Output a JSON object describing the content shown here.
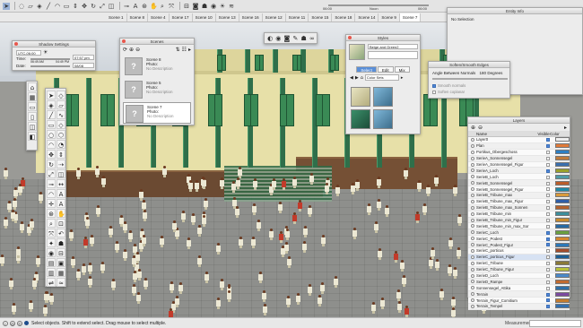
{
  "toolbar": {
    "icons": [
      "select-arrow-icon",
      "lasso-icon",
      "eraser-icon",
      "paint-bucket-icon",
      "line-icon",
      "arc-icon",
      "rectangle-icon",
      "push-pull-icon",
      "move-icon",
      "rotate-icon",
      "scale-icon",
      "offset-icon",
      "tape-measure-icon",
      "text-icon",
      "orbit-icon",
      "pan-icon",
      "zoom-icon",
      "zoom-extents-icon",
      "section-icon",
      "camera-icon",
      "walk-icon",
      "look-around-icon",
      "shadow-icon",
      "fog-icon"
    ]
  },
  "sun_bar": {
    "start_time": "06:00",
    "mid_time": "Noon",
    "end_time": "06:00"
  },
  "scene_tabs": [
    "Scene 1",
    "Scene 8",
    "Scene 4",
    "Scene 17",
    "Scene 10",
    "Scene 13",
    "Scene 16",
    "Scene 12",
    "Scene 11",
    "Scene 15",
    "Scene 18",
    "Scene 14",
    "Scene 9",
    "Scene 7"
  ],
  "active_scene_tab": "Scene 7",
  "entity_info": {
    "title": "Entity Info",
    "text": "No Selection"
  },
  "shadow_settings": {
    "title": "Shadow Settings",
    "timezone": "UTC-06:00",
    "time_label": "Time:",
    "time_start": "06:49 AM",
    "time_value": "07:57 pm",
    "time_end": "04:49 PM",
    "date_label": "Date:",
    "date_value": "08/08"
  },
  "scenes_panel": {
    "title": "Scenes",
    "items": [
      {
        "name": "Scene 8",
        "photo_label": "Photo:",
        "desc": "No Description"
      },
      {
        "name": "Scene 5",
        "photo_label": "Photo:",
        "desc": "No Description"
      },
      {
        "name": "Scene 7",
        "photo_label": "Photo:",
        "desc": "No Description"
      }
    ]
  },
  "styles_panel": {
    "title": "Styles",
    "style_name": "Beige and Green2",
    "tabs": [
      "Select",
      "Edit",
      "Mix"
    ],
    "active_tab": "Select",
    "collection": "Color Sets"
  },
  "soften_edges": {
    "title": "Soften/Smooth Edges",
    "angle_label": "Angle Between Normals",
    "angle_value": "180",
    "angle_unit": "Degrees",
    "smooth_normals": "Smooth normals",
    "soften_coplanar": "Soften coplanar"
  },
  "layers_panel": {
    "title": "Layers",
    "col_name": "Name",
    "col_visible": "Visible",
    "col_color": "Color",
    "rows": [
      {
        "name": "Layer0",
        "visible": true,
        "color": "#eeeeee"
      },
      {
        "name": "Plan",
        "visible": true,
        "color": "#e07a38"
      },
      {
        "name": "Portikus_Obergeschoss",
        "visible": false,
        "color": "#2d7fc4"
      },
      {
        "name": "SerieA_Sonnensegel",
        "visible": false,
        "color": "#c07b3b"
      },
      {
        "name": "SerieA_Sonnensegel_Figur",
        "visible": false,
        "color": "#3a6fae"
      },
      {
        "name": "SerieA_Loch",
        "visible": true,
        "color": "#9aa02a"
      },
      {
        "name": "SerieB_Loch",
        "visible": false,
        "color": "#4f9ca7"
      },
      {
        "name": "SerieB_Sonnensegel",
        "visible": false,
        "color": "#bb5d2b"
      },
      {
        "name": "SerieB_Sonnensegel_Figur",
        "visible": false,
        "color": "#1f8aa7"
      },
      {
        "name": "SerieB_Tribune_max",
        "visible": false,
        "color": "#d99a3c"
      },
      {
        "name": "SerieB_Tribune_max_Figur",
        "visible": false,
        "color": "#2f5ea8"
      },
      {
        "name": "SerieB_Tribune_max_Sonnen",
        "visible": false,
        "color": "#b3622e"
      },
      {
        "name": "SerieB_Tribune_min",
        "visible": false,
        "color": "#3c8e9c"
      },
      {
        "name": "SerieB_Tribune_min_Figur",
        "visible": false,
        "color": "#c88a2d"
      },
      {
        "name": "SerieB_Tribune_min_max_Sor",
        "visible": false,
        "color": "#276aa3"
      },
      {
        "name": "SerieC_Loch",
        "visible": true,
        "color": "#6aa040"
      },
      {
        "name": "SerieC_Podest",
        "visible": true,
        "color": "#d4862f"
      },
      {
        "name": "SerieC_Podest_Figur",
        "visible": true,
        "color": "#2c78b8"
      },
      {
        "name": "SerieC_porticus",
        "visible": false,
        "color": "#a34c2c"
      },
      {
        "name": "SerieC_porticus_Figur",
        "visible": false,
        "color": "#1c5f96"
      },
      {
        "name": "SerieC_Tribune",
        "visible": false,
        "color": "#8a7a3a"
      },
      {
        "name": "SerieC_Tribune_Figur",
        "visible": false,
        "color": "#b7c13c"
      },
      {
        "name": "SerieD_Loch",
        "visible": false,
        "color": "#4a88c9"
      },
      {
        "name": "SerieD_Rampe",
        "visible": false,
        "color": "#c26b2f"
      },
      {
        "name": "Sonnensegel_Attika",
        "visible": false,
        "color": "#2e6fa8"
      },
      {
        "name": "Terrain",
        "visible": true,
        "color": "#7b4aa0"
      },
      {
        "name": "Terrain_Figur_Comitium",
        "visible": true,
        "color": "#c47c2e"
      },
      {
        "name": "Terrain_Tempel",
        "visible": true,
        "color": "#3270b0"
      }
    ],
    "selected_row": "SerieC_porticus_Figur"
  },
  "tools_palette": {
    "icons": [
      "select-icon",
      "component-icon",
      "paint-icon",
      "eraser-icon",
      "line-icon",
      "freehand-icon",
      "rectangle-icon",
      "rotated-rect-icon",
      "circle-icon",
      "polygon-icon",
      "arc-icon",
      "pie-icon",
      "move-icon",
      "push-pull-icon",
      "rotate-icon",
      "follow-me-icon",
      "scale-icon",
      "offset-icon",
      "tape-icon",
      "dimension-icon",
      "protractor-icon",
      "text-icon",
      "axes-icon",
      "3d-text-icon",
      "orbit-icon",
      "pan-icon",
      "zoom-icon",
      "zoom-window-icon",
      "zoom-extents-icon",
      "previous-view-icon",
      "position-camera-icon",
      "walk-icon",
      "look-around-icon",
      "section-plane-icon",
      "sandbox-icon",
      "stamp-icon",
      "drape-icon",
      "add-detail-icon",
      "flip-edge-icon",
      "smoove-icon"
    ]
  },
  "status_bar": {
    "hint": "Select objects. Shift to extend select. Drag mouse to select multiple.",
    "measurements_label": "Measurements"
  }
}
